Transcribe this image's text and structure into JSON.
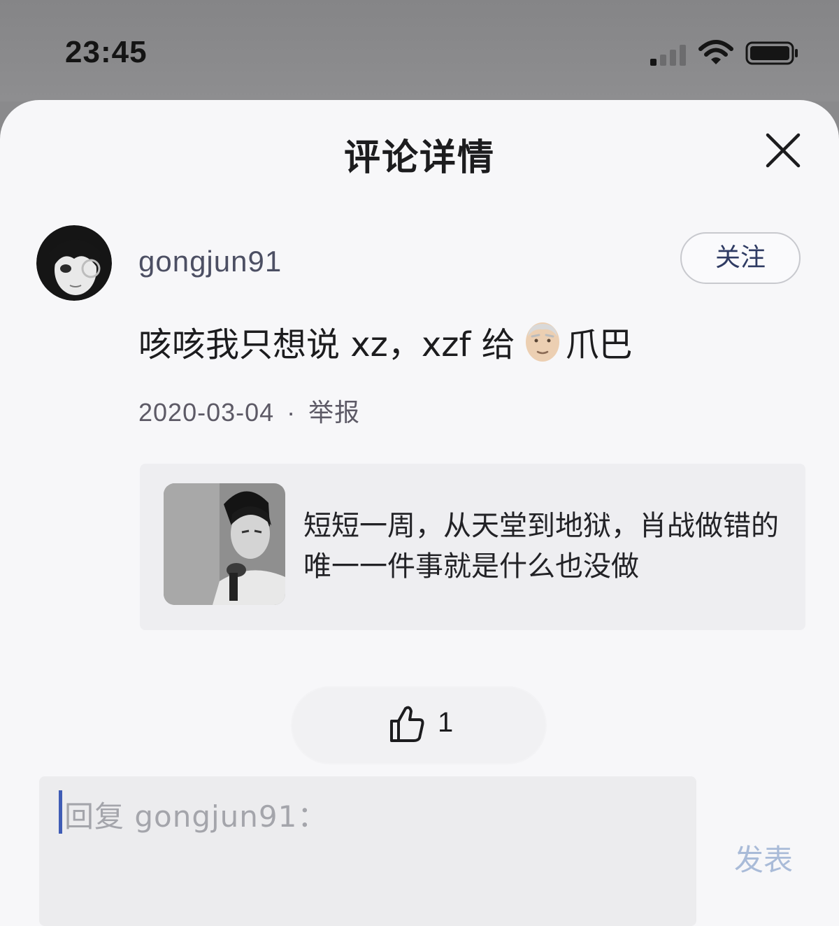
{
  "status_bar": {
    "time": "23:45"
  },
  "sheet": {
    "title": "评论详情",
    "close_icon": "close-icon"
  },
  "comment": {
    "username": "gongjun91",
    "follow_label": "关注",
    "text_part1": "咳咳我只想说 xz，",
    "text_part2": "xzf 给",
    "text_part3": "爪巴",
    "emoji": "old-man-face",
    "date": "2020-03-04",
    "separator": "·",
    "report_label": "举报"
  },
  "quote": {
    "text": "短短一周，从天堂到地狱，肖战做错的唯一一件事就是什么也没做"
  },
  "like": {
    "icon": "thumbs-up-icon",
    "count": "1"
  },
  "reply": {
    "placeholder": "回复 gongjun91：",
    "publish_label": "发表"
  },
  "colors": {
    "accent": "#3f5cb5",
    "publish_disabled": "#a9bbd8"
  }
}
